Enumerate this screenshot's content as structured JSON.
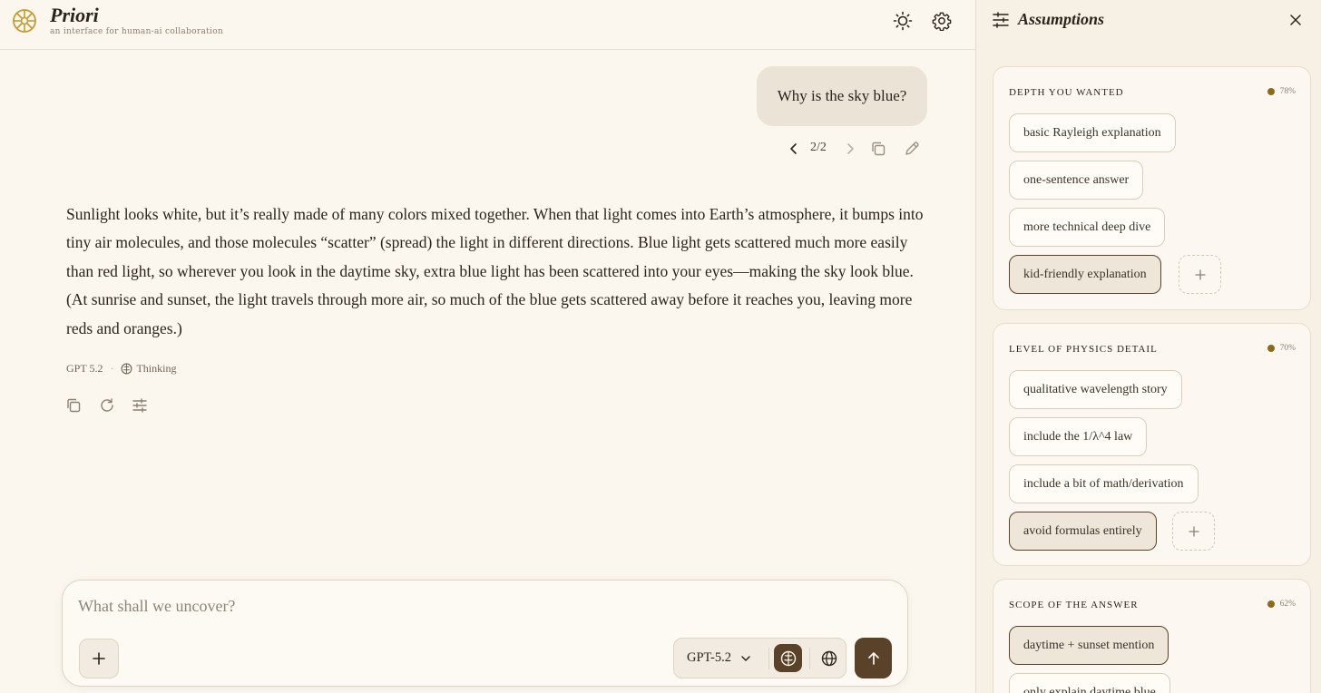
{
  "app": {
    "name": "Priori",
    "tagline": "an interface for human-ai collaboration"
  },
  "header": {
    "theme_icon": "sun-icon",
    "settings_icon": "gear-icon"
  },
  "conversation": {
    "user_message": "Why is the sky blue?",
    "pager": "2/2",
    "assistant_message": "Sunlight looks white, but it’s really made of many colors mixed together. When that light comes into Earth’s atmosphere, it bumps into tiny air molecules, and those molecules “scatter” (spread) the light in different directions. Blue light gets scattered much more easily than red light, so wherever you look in the daytime sky, extra blue light has been scattered into your eyes—making the sky look blue. (At sunrise and sunset, the light travels through more air, so much of the blue gets scattered away before it reaches you, leaving more reds and oranges.)",
    "model_label": "GPT 5.2",
    "mode_label": "Thinking"
  },
  "composer": {
    "placeholder": "What shall we uncover?",
    "model": "GPT-5.2"
  },
  "panel": {
    "title": "Assumptions",
    "groups": [
      {
        "label": "Depth you wanted",
        "confidence": "78%",
        "options": [
          {
            "label": "basic Rayleigh explanation",
            "selected": false
          },
          {
            "label": "one-sentence answer",
            "selected": false
          },
          {
            "label": "more technical deep dive",
            "selected": false
          },
          {
            "label": "kid-friendly explanation",
            "selected": true
          }
        ]
      },
      {
        "label": "Level of physics detail",
        "confidence": "70%",
        "options": [
          {
            "label": "qualitative wavelength story",
            "selected": false
          },
          {
            "label": "include the 1/λ^4 law",
            "selected": false
          },
          {
            "label": "include a bit of math/derivation",
            "selected": false
          },
          {
            "label": "avoid formulas entirely",
            "selected": true
          }
        ]
      },
      {
        "label": "Scope of the answer",
        "confidence": "62%",
        "options": [
          {
            "label": "daytime + sunset mention",
            "selected": true
          },
          {
            "label": "only explain daytime blue",
            "selected": false
          }
        ]
      }
    ]
  },
  "colors": {
    "background": "#fbf7ef",
    "panel_background": "#f6f0e5",
    "accent_brown": "#5a4129",
    "logo_gold": "#c79a2e",
    "confidence_dot": "#8a6a1e"
  }
}
